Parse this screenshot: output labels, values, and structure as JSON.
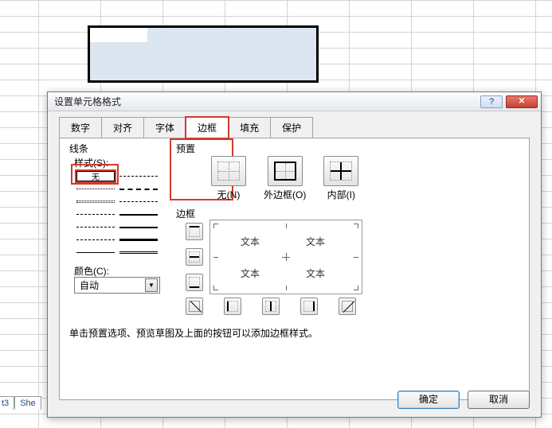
{
  "sheet_tabs": {
    "partial": "t3",
    "next": "She"
  },
  "dialog": {
    "title": "设置单元格格式",
    "help": "?",
    "close": "✕",
    "tabs": {
      "number": "数字",
      "alignment": "对齐",
      "font": "字体",
      "border": "边框",
      "fill": "填充",
      "protection": "保护"
    },
    "line_group": "线条",
    "style_label": "样式(S):",
    "style_none": "无",
    "color_label": "颜色(C):",
    "color_value": "自动",
    "preset_group": "预置",
    "presets": {
      "none": "无(N)",
      "outline": "外边框(O)",
      "inside": "内部(I)"
    },
    "border_group": "边框",
    "preview_text": "文本",
    "hint": "单击预置选项、预览草图及上面的按钮可以添加边框样式。",
    "ok": "确定",
    "cancel": "取消"
  }
}
